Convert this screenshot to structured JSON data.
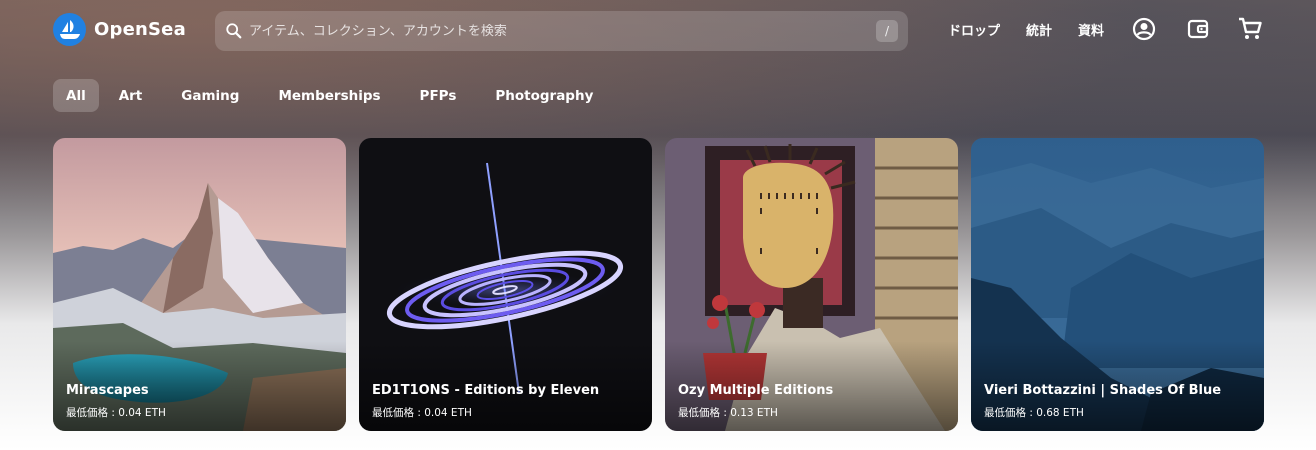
{
  "header": {
    "brand": "OpenSea",
    "search_placeholder": "アイテム、コレクション、アカウントを検索",
    "search_shortcut": "/",
    "nav": [
      "ドロップ",
      "統計",
      "資料"
    ],
    "icons": [
      "account-icon",
      "wallet-icon",
      "cart-icon"
    ]
  },
  "tabs": {
    "items": [
      "All",
      "Art",
      "Gaming",
      "Memberships",
      "PFPs",
      "Photography"
    ],
    "active": "All"
  },
  "cards": [
    {
      "title": "Mirascapes",
      "price": "最低価格 : 0.04 ETH"
    },
    {
      "title": "ED1T1ONS - Editions by Eleven",
      "price": "最低価格 : 0.04 ETH"
    },
    {
      "title": "Ozy Multiple Editions",
      "price": "最低価格 : 0.13 ETH"
    },
    {
      "title": "Vieri Bottazzini | Shades Of Blue",
      "price": "最低価格 : 0.68 ETH"
    }
  ],
  "colors": {
    "brand": "#2081e2",
    "text": "#ffffff"
  }
}
